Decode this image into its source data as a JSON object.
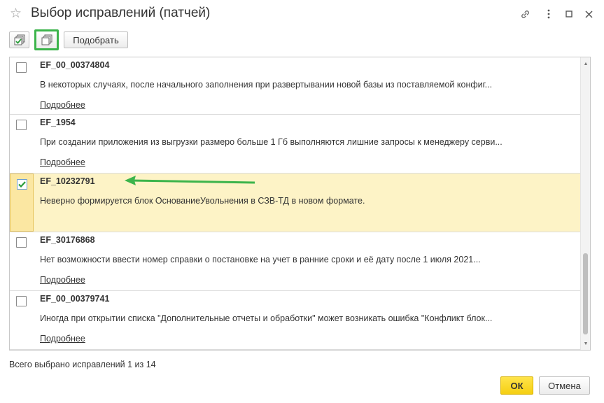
{
  "window": {
    "title": "Выбор исправлений (патчей)"
  },
  "toolbar": {
    "check_all_icon": "check-all-icon",
    "uncheck_all_icon": "uncheck-all-icon",
    "pick_label": "Подобрать"
  },
  "patches": [
    {
      "code": "EF_00_00374804",
      "description": "В некоторых случаях, после начального заполнения при развертывании новой базы из поставляемой конфиг...",
      "more_label": "Подробнее",
      "checked": false
    },
    {
      "code": "EF_1954",
      "description": "При создании приложения из выгрузки размеро больше 1 Гб выполняются лишние запросы к менеджеру серви...",
      "more_label": "Подробнее",
      "checked": false
    },
    {
      "code": "EF_10232791",
      "description": "Неверно формируется блок ОснованиеУвольнения в СЗВ-ТД в новом формате.",
      "more_label": "",
      "checked": true
    },
    {
      "code": "EF_30176868",
      "description": "Нет возможности ввести номер справки о постановке на учет в ранние сроки и её дату после 1 июля 2021...",
      "more_label": "Подробнее",
      "checked": false
    },
    {
      "code": "EF_00_00379741",
      "description": "Иногда при открытии списка \"Дополнительные отчеты и обработки\" может возникать ошибка \"Конфликт блок...",
      "more_label": "Подробнее",
      "checked": false
    }
  ],
  "status": {
    "text": "Всего выбрано исправлений 1 из 14"
  },
  "footer": {
    "ok_label": "ОК",
    "cancel_label": "Отмена"
  },
  "colors": {
    "accent_green": "#3cb44b",
    "selected_row": "#fdf3c6",
    "ok_button": "#f5cf12"
  }
}
